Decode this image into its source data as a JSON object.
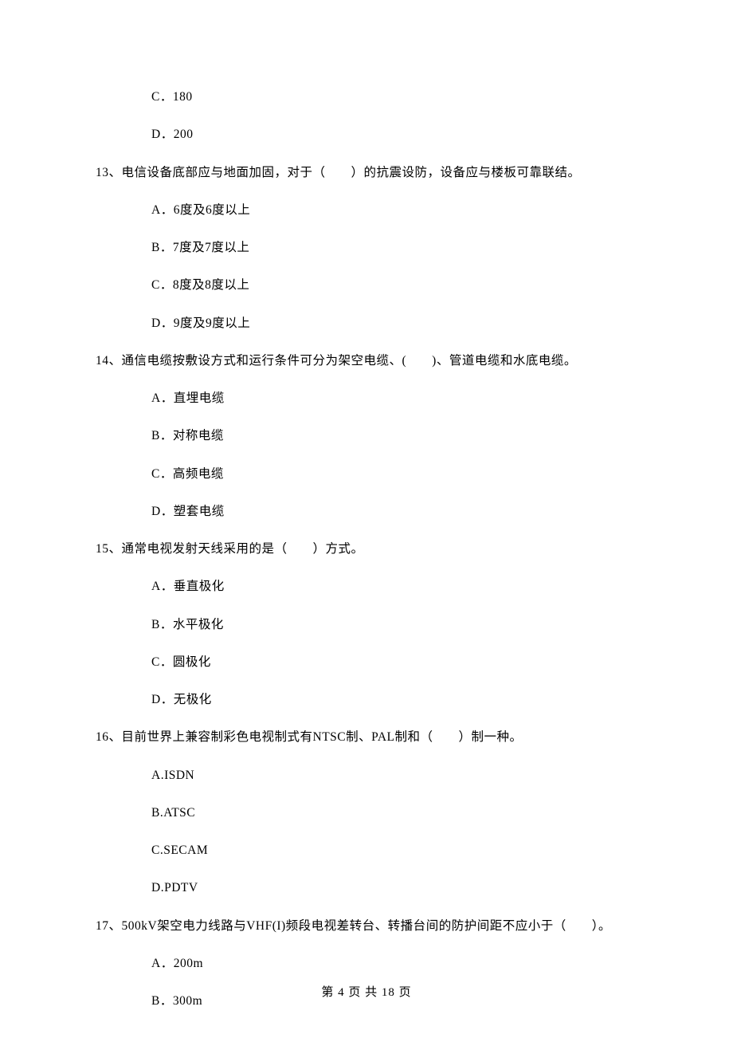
{
  "firstOptions": [
    "C．180",
    "D．200"
  ],
  "questions": [
    {
      "stem": "13、电信设备底部应与地面加固，对于（　　）的抗震设防，设备应与楼板可靠联结。",
      "options": [
        "A．6度及6度以上",
        "B．7度及7度以上",
        "C．8度及8度以上",
        "D．9度及9度以上"
      ]
    },
    {
      "stem": "14、通信电缆按敷设方式和运行条件可分为架空电缆、(　　)、管道电缆和水底电缆。",
      "options": [
        "A．直埋电缆",
        "B．对称电缆",
        "C．高频电缆",
        "D．塑套电缆"
      ]
    },
    {
      "stem": "15、通常电视发射天线采用的是（　　）方式。",
      "options": [
        "A．垂直极化",
        "B．水平极化",
        "C．圆极化",
        "D．无极化"
      ]
    },
    {
      "stem": "16、目前世界上兼容制彩色电视制式有NTSC制、PAL制和（　　）制一种。",
      "options": [
        "A.ISDN",
        "B.ATSC",
        "C.SECAM",
        "D.PDTV"
      ]
    },
    {
      "stem": "17、500kV架空电力线路与VHF(I)频段电视差转台、转播台间的防护间距不应小于（　　）。",
      "options": [
        "A．200m",
        "B．300m"
      ]
    }
  ],
  "footer": "第 4 页 共 18 页"
}
